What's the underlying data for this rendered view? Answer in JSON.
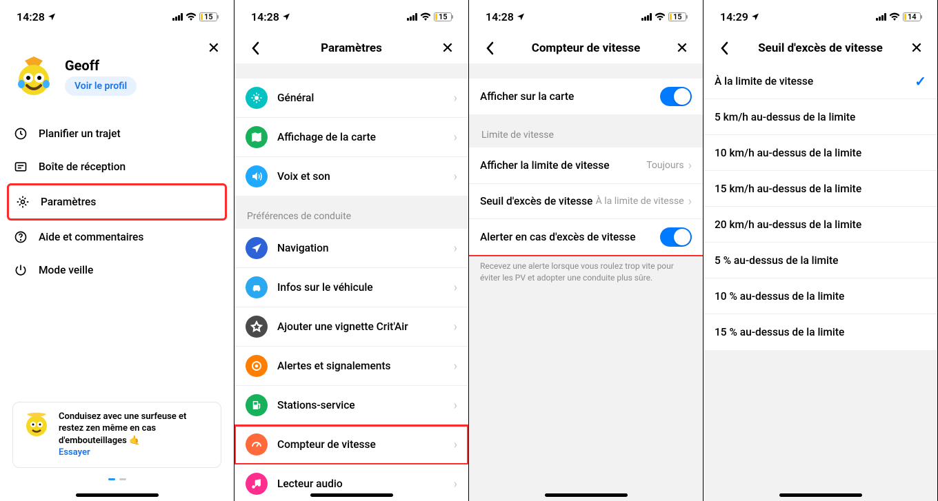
{
  "status": {
    "time1": "14:28",
    "time4": "14:29",
    "battery1": "15",
    "battery4": "14"
  },
  "p1": {
    "name": "Geoff",
    "view_profile": "Voir le profil",
    "menu": {
      "plan": "Planifier un trajet",
      "inbox": "Boîte de réception",
      "settings": "Paramètres",
      "help": "Aide et commentaires",
      "sleep": "Mode veille"
    },
    "promo": {
      "text": "Conduisez avec une surfeuse et restez zen même en cas d'embouteillages 🤙",
      "try": "Essayer"
    }
  },
  "p2": {
    "title": "Paramètres",
    "general": "Général",
    "map": "Affichage de la carte",
    "voice": "Voix et son",
    "driving_header": "Préférences de conduite",
    "nav": "Navigation",
    "vehicle": "Infos sur le véhicule",
    "critair": "Ajouter une vignette Crit'Air",
    "alerts": "Alertes et signalements",
    "gas": "Stations-service",
    "speed": "Compteur de vitesse",
    "audio": "Lecteur audio"
  },
  "p3": {
    "title": "Compteur de vitesse",
    "show_on_map": "Afficher sur la carte",
    "limit_header": "Limite de vitesse",
    "show_limit": "Afficher la limite de vitesse",
    "show_limit_val": "Toujours",
    "threshold": "Seuil d'excès de vitesse",
    "threshold_val": "À la limite de vitesse",
    "alert": "Alerter en cas d'excès de vitesse",
    "footnote": "Recevez une alerte lorsque vous roulez trop vite pour éviter les PV et adopter une conduite plus sûre."
  },
  "p4": {
    "title": "Seuil d'excès de vitesse",
    "opts": [
      "À la limite de vitesse",
      "5 km/h au-dessus de la limite",
      "10 km/h au-dessus de la limite",
      "15 km/h au-dessus de la limite",
      "20 km/h au-dessus de la limite",
      "5 % au-dessus de la limite",
      "10 % au-dessus de la limite",
      "15 % au-dessus de la limite"
    ]
  },
  "colors": {
    "general": "#05c2c2",
    "map": "#17b05b",
    "voice": "#1faaff",
    "nav": "#2d63d6",
    "vehicle": "#2aa9f0",
    "critair": "#4a4a4a",
    "alerts": "#ff7e00",
    "gas": "#17b05b",
    "speed": "#ff6a3d",
    "audio": "#ff2d8e"
  }
}
